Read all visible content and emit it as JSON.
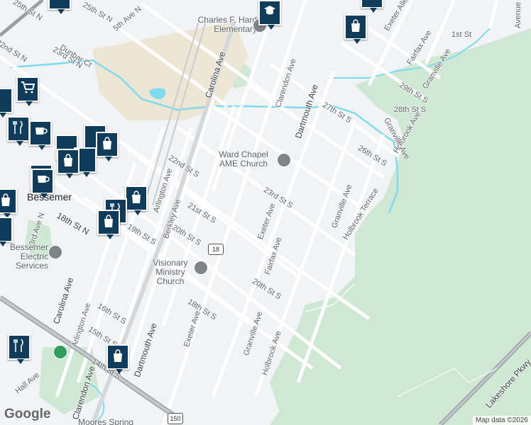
{
  "map": {
    "city": "Bessemer",
    "streets": [
      "25th St N",
      "22nd St N",
      "23rd St N",
      "Dunbar Ct",
      "5th Ave N",
      "Carolina Ave",
      "Clarendon Ave",
      "Dartmouth Ave",
      "27th St S",
      "28th St S",
      "29th St S",
      "26th St S",
      "Fairfax Ave",
      "Granville Ave",
      "Holbrook Ave",
      "Holbrook Terrace",
      "Exeter Ave",
      "23rd St S",
      "22nd St S",
      "21st St S",
      "20th St S",
      "19th St S",
      "18th St S",
      "16th St S",
      "15th St S",
      "14th St S",
      "18th St N",
      "Arlington Ave",
      "Berkley Ave",
      "Hall Ave",
      "3rd Ave N",
      "Lakeshore Pkwy",
      "1st St",
      "Exeter Alley",
      "Avenue"
    ],
    "pois": [
      "Charles F. Hard Elementary",
      "Ward Chapel AME Church",
      "Visionary Ministry Church",
      "Bessemer Electric Services",
      "Moores Spring"
    ],
    "route_shields": [
      "18",
      "150"
    ],
    "footer": "Map data ©2026",
    "logo": "Google"
  },
  "colors": {
    "land": "#f2f3f5",
    "park": "#cfe8d3",
    "water": "#7fdbee",
    "pin": "#0f3c5a",
    "road": "#ffffff"
  }
}
